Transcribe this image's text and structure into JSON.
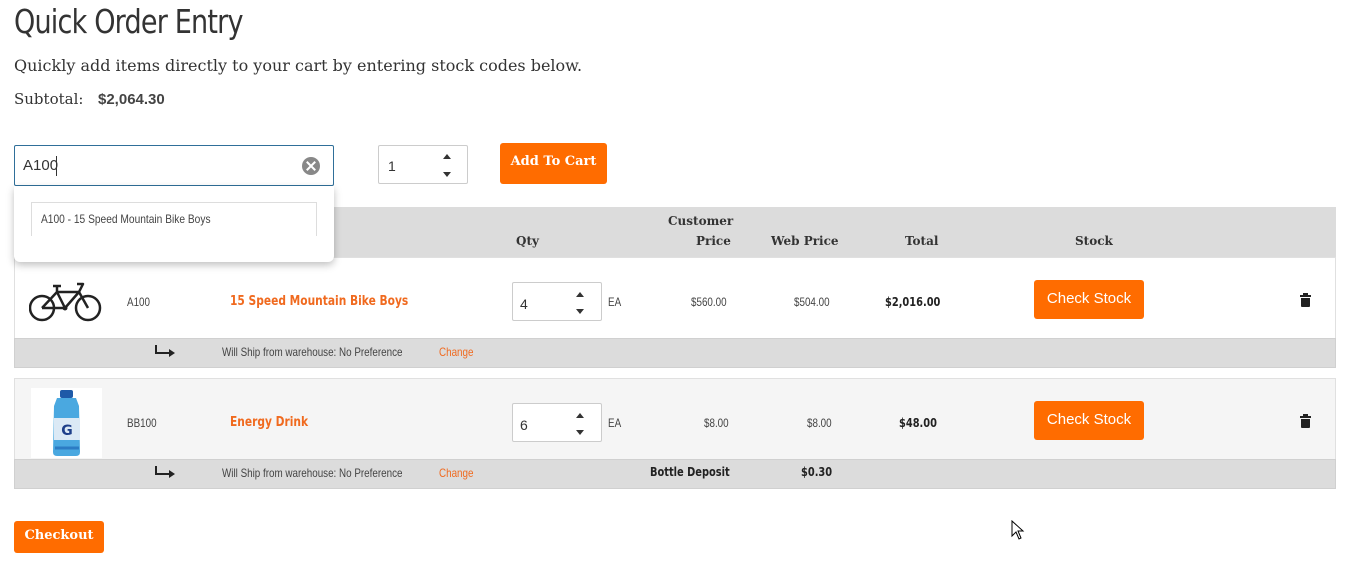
{
  "page": {
    "title": "Quick Order Entry",
    "subtitle": "Quickly add items directly to your cart by entering stock codes below.",
    "subtotal_label": "Subtotal:",
    "subtotal_value": "$2,064.30"
  },
  "entry": {
    "search_value": "A100",
    "suggestion": "A100 - 15 Speed Mountain Bike Boys",
    "qty_value": "1",
    "add_to_cart_label": "Add To Cart"
  },
  "table": {
    "headers": {
      "qty": "Qty",
      "customer_price_line1": "Customer",
      "customer_price_line2": "Price",
      "web_price": "Web Price",
      "total": "Total",
      "stock": "Stock"
    },
    "rows": [
      {
        "code": "A100",
        "name": "15 Speed Mountain Bike Boys",
        "qty": "4",
        "uom": "EA",
        "customer_price": "$560.00",
        "web_price": "$504.00",
        "total": "$2,016.00",
        "check_stock_label": "Check Stock",
        "ship_text": "Will Ship from warehouse: No Preference",
        "change_label": "Change"
      },
      {
        "code": "BB100",
        "name": "Energy Drink",
        "qty": "6",
        "uom": "EA",
        "customer_price": "$8.00",
        "web_price": "$8.00",
        "total": "$48.00",
        "check_stock_label": "Check Stock",
        "ship_text": "Will Ship from warehouse: No Preference",
        "change_label": "Change",
        "deposit_label": "Bottle Deposit",
        "deposit_value": "$0.30"
      }
    ]
  },
  "checkout_label": "Checkout",
  "colors": {
    "accent": "#ff6c00",
    "link": "#f06a1f",
    "header_bg": "#dcdcdc",
    "focus_border": "#2f6f99"
  },
  "icons": [
    "clear-icon",
    "trash-icon",
    "ship-arrow-icon",
    "bike-image",
    "drink-image"
  ]
}
